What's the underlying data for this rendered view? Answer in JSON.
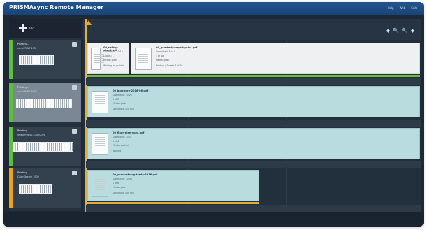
{
  "app": {
    "title": "PRISMAsync Remote Manager",
    "links": [
      "Help",
      "Web",
      "Exit"
    ]
  },
  "left": {
    "add_label": "Add",
    "devices": [
      {
        "status": "Printing...",
        "name": "varioPRINT 135",
        "stripe": "#5fbf3a"
      },
      {
        "status": "Printing...",
        "name": "varioPRINT 6000",
        "stripe": "#5fbf3a"
      },
      {
        "status": "Printing...",
        "name": "imagePRESS C10000VP",
        "stripe": "#5fbf3a"
      },
      {
        "status": "Printing...",
        "name": "ColorStream 3900",
        "stripe": "#f0a31a"
      }
    ]
  },
  "toolbar": {
    "icons": [
      "pan-left-icon",
      "zoom-out-icon",
      "zoom-in-icon",
      "pan-right-icon"
    ],
    "glyphs": [
      "◆",
      "🔍",
      "🔍",
      "◆"
    ]
  },
  "lanes": [
    {
      "jobs": [
        {
          "title": "00_safety-sheet.pdf",
          "lines": [
            "Submitted: 10:12",
            "Copies: 1",
            "Media: plain",
            "Waiting for printer"
          ],
          "style": "light"
        },
        {
          "title": "00_quarterly-report-print.pdf",
          "lines": [
            "Submitted: 10:14",
            "1 of 18",
            "Media: plain",
            "Printing / Sheets 3 of 18"
          ],
          "style": "light"
        }
      ]
    },
    {
      "jobs": [
        {
          "title": "00_brochure-2016-06.pdf",
          "lines": [
            "Submitted: 10:20",
            "1 of 2",
            "Media: gloss",
            "Scheduled / 20 min"
          ],
          "style": "teal"
        }
      ]
    },
    {
      "jobs": [
        {
          "title": "00_floor-plan-spec.pdf",
          "lines": [
            "Submitted: 10:31",
            "1 of 4",
            "Media: coated",
            "Waiting"
          ],
          "style": "teal"
        }
      ]
    },
    {
      "jobs": [
        {
          "title": "00_year-catalog-trade-2016.pdf",
          "lines": [
            "Submitted: 10:44",
            "1 of 6",
            "Media: plain",
            "Scheduled / 45 min"
          ],
          "style": "teal"
        }
      ]
    }
  ],
  "colors": {
    "accent": "#1a4477",
    "ready": "#5fbf3a",
    "warning": "#f0a31a",
    "job": "#b9dcdf"
  }
}
